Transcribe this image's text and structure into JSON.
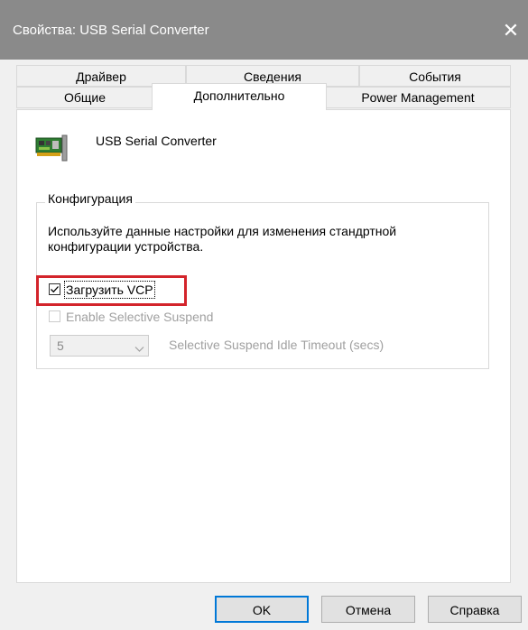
{
  "window": {
    "title": "Свойства: USB Serial Converter",
    "close_label": "✕"
  },
  "tabs": {
    "row1": [
      "Драйвер",
      "Сведения",
      "События"
    ],
    "row2": [
      "Общие",
      "Дополнительно",
      "Power Management"
    ],
    "active": "Дополнительно"
  },
  "device": {
    "name": "USB Serial Converter",
    "icon": "network-card-icon"
  },
  "config": {
    "group_title": "Конфигурация",
    "description": "Используйте данные настройки для изменения стандртной конфигурации устройства.",
    "load_vcp": {
      "label": "Загрузить VCP",
      "checked": true
    },
    "selective_suspend": {
      "label": "Enable Selective Suspend",
      "checked": false,
      "enabled": false
    },
    "idle_timeout": {
      "value": "5",
      "caption": "Selective Suspend Idle Timeout (secs)",
      "enabled": false
    }
  },
  "buttons": {
    "ok": "OK",
    "cancel": "Отмена",
    "help": "Справка"
  },
  "colors": {
    "titlebar": "#8a8a8a",
    "highlight": "#d3242b",
    "default_button_border": "#0078d7"
  }
}
